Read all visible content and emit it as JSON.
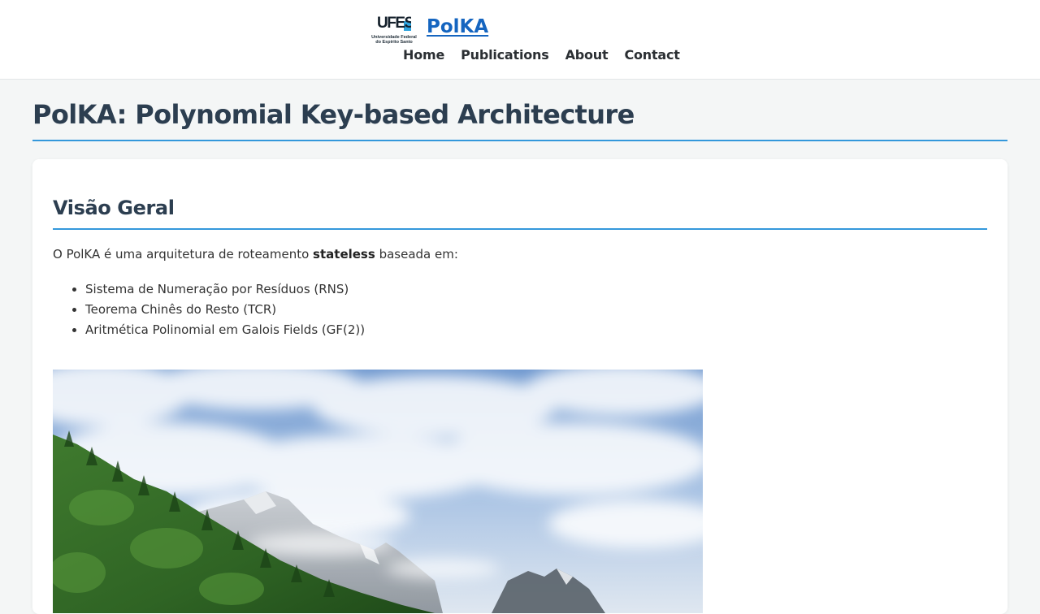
{
  "header": {
    "logo_text": "UFES",
    "logo_caption_1": "Universidade Federal",
    "logo_caption_2": "do Espírito Santo",
    "brand_name": "PolKA",
    "nav": [
      {
        "label": "Home"
      },
      {
        "label": "Publications"
      },
      {
        "label": "About"
      },
      {
        "label": "Contact"
      }
    ]
  },
  "page": {
    "title": "PolKA: Polynomial Key-based Architecture"
  },
  "section": {
    "title": "Visão Geral",
    "intro_before": "O PolKA é uma arquitetura de roteamento ",
    "intro_bold": "stateless",
    "intro_after": " baseada em:",
    "features": [
      "Sistema de Numeração por Resíduos (RNS)",
      "Teorema Chinês do Resto (TCR)",
      "Aritmética Polinomial em Galois Fields (GF(2))"
    ]
  },
  "colors": {
    "brand_link": "#1565c0",
    "accent_rule": "#3498db",
    "heading": "#2c3e50",
    "page_background": "#f4f6f6"
  },
  "icons": {
    "logo": "ufes-logo-icon",
    "photo": "mountain-landscape-photo"
  }
}
